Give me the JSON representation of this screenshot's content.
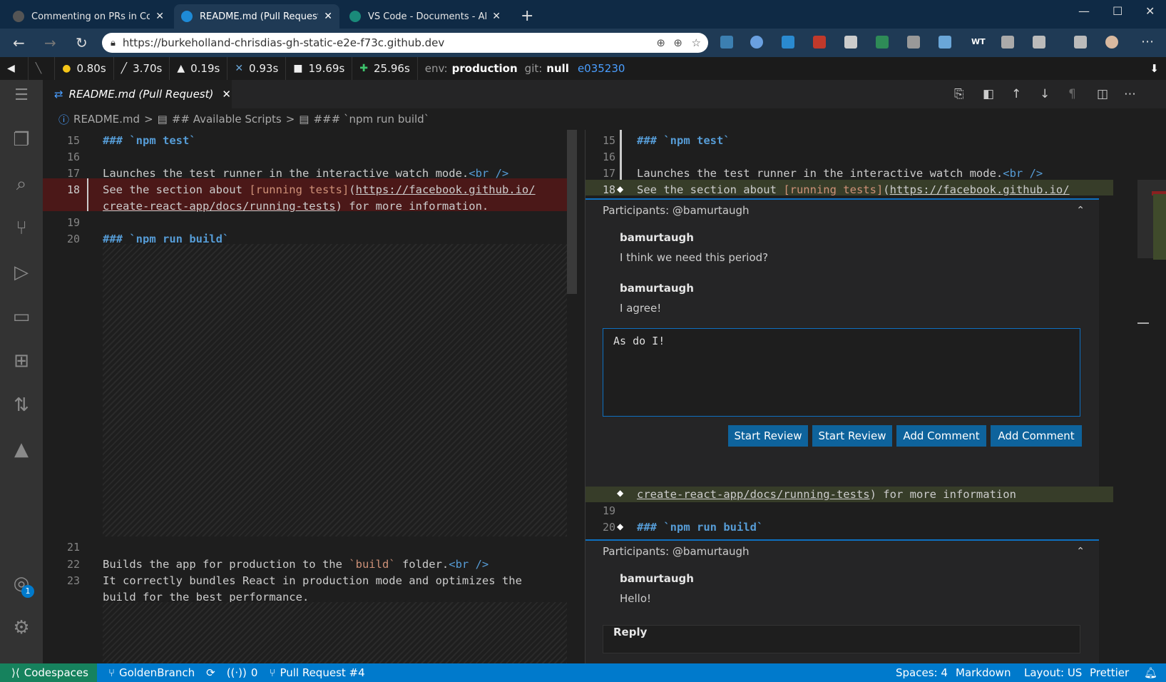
{
  "browser": {
    "tabs": [
      {
        "title": "Commenting on PRs in Codespa",
        "color": "#444"
      },
      {
        "title": "README.md (Pull Request) - gh",
        "color": "#1e8ad6"
      },
      {
        "title": "VS Code - Documents - All Docu",
        "color": "#1a8a7a"
      }
    ],
    "url": "https://burkeholland-chrisdias-gh-static-e2e-f73c.github.dev",
    "ext_labels": [
      "WT"
    ]
  },
  "perf": {
    "items": [
      {
        "icon": "lamp-icon",
        "glyph": "◀",
        "value": ""
      },
      {
        "icon": "brush-icon",
        "glyph": "╲",
        "value": ""
      },
      {
        "icon": "head-icon",
        "glyph": "●",
        "value": "0.80s"
      },
      {
        "icon": "wand-icon",
        "glyph": "╱",
        "value": "3.70s"
      },
      {
        "icon": "rocket-icon",
        "glyph": "▲",
        "value": "0.19s"
      },
      {
        "icon": "tools-icon",
        "glyph": "✕",
        "value": "0.93s"
      },
      {
        "icon": "book-icon",
        "glyph": "■",
        "value": "19.69s"
      },
      {
        "icon": "puzzle-icon",
        "glyph": "✚",
        "value": "25.96s"
      }
    ],
    "env_label": "env:",
    "env_value": "production",
    "git_label": "git:",
    "git_value": "null",
    "hash": "e035230",
    "arrow": "⬇"
  },
  "editor": {
    "tab_title": "README.md (Pull Request)",
    "breadcrumb": [
      "README.md",
      ">",
      "## Available Scripts",
      ">",
      "### `npm run build`"
    ],
    "left_lines": [
      {
        "num": "15",
        "text": "### `npm test`"
      },
      {
        "num": "16",
        "text": ""
      },
      {
        "num": "17",
        "text": "Launches the test runner in the interactive watch mode."
      },
      {
        "num": "18",
        "text": "See the section about "
      },
      {
        "num": "19",
        "text": ""
      },
      {
        "num": "20",
        "text": "### `npm run build`"
      },
      {
        "num": "21",
        "text": ""
      },
      {
        "num": "22",
        "text": "Builds the app for production to the "
      },
      {
        "num": "23",
        "text": "It correctly bundles React in production mode and optimizes the"
      }
    ],
    "br": "<br />",
    "running_tests": "[running tests]",
    "paren_open": "(",
    "fb_url": "https://facebook.github.io/",
    "cra_url": "create-react-app/docs/running-tests",
    "more_info_left": ") for more information.",
    "more_info_right": ") for more information",
    "build_word": "`build`",
    "folder_text": " folder.",
    "perf_line": "build for the best performance.",
    "comment1": {
      "participants": "Participants: @bamurtaugh",
      "comments": [
        {
          "author": "bamurtaugh",
          "body": "I think we need this period?"
        },
        {
          "author": "bamurtaugh",
          "body": "I agree!"
        }
      ],
      "reply_value": "As do I!",
      "buttons": [
        "Start Review",
        "Start Review",
        "Add Comment",
        "Add Comment"
      ]
    },
    "comment2": {
      "participants": "Participants: @bamurtaugh",
      "comments": [
        {
          "author": "bamurtaugh",
          "body": "Hello!"
        }
      ],
      "reply_label": "Reply"
    }
  },
  "status": {
    "remote": "Codespaces",
    "branch": "GoldenBranch",
    "ports": "0",
    "pr": "Pull Request #4",
    "spaces": "Spaces: 4",
    "lang": "Markdown",
    "layout": "Layout: US",
    "prettier": "Prettier",
    "badge": "1"
  }
}
